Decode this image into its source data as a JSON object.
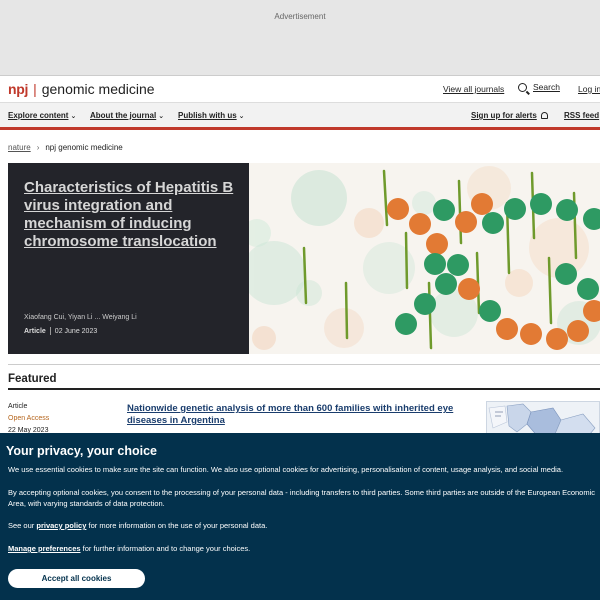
{
  "ad": {
    "label": "Advertisement"
  },
  "header": {
    "brand_prefix": "npj",
    "brand_separator": "|",
    "brand_name": "genomic medicine",
    "view_all_journals": "View all journals",
    "search_label": "Search",
    "login_label": "Log in"
  },
  "nav": {
    "explore_content": "Explore content",
    "about_journal": "About the journal",
    "publish_with_us": "Publish with us",
    "sign_up_alerts": "Sign up for alerts",
    "rss_feed": "RSS feed"
  },
  "breadcrumb": {
    "root": "nature",
    "separator": "›",
    "current": "npj genomic medicine"
  },
  "hero": {
    "title": "Characteristics of Hepatitis B virus integration and mechanism of inducing chromosome translocation",
    "authors": "Xiaofang Cui, Yiyan Li ... Weiyang Li",
    "type": "Article",
    "date": "02 June 2023"
  },
  "featured": {
    "heading": "Featured",
    "article": {
      "type": "Article",
      "access": "Open Access",
      "date": "22 May 2023",
      "title": "Nationwide genetic analysis of more than 600 families with inherited eye diseases in Argentina"
    }
  },
  "cookie_banner": {
    "title": "Your privacy, your choice",
    "p1": "We use essential cookies to make sure the site can function. We also use optional cookies for advertising, personalisation of content, usage analysis, and social media.",
    "p2": "By accepting optional cookies, you consent to the processing of your personal data - including transfers to third parties. Some third parties are outside of the European Economic Area, with varying standards of data protection.",
    "p3_before": "See our",
    "p3_link": "privacy policy",
    "p3_after": "for more information on the use of your personal data.",
    "p4_link": "Manage preferences",
    "p4_after": "for further information and to change your choices.",
    "accept_button": "Accept all cookies"
  },
  "colors": {
    "brand_red": "#c0392b",
    "nav_bg": "#f2f2f2",
    "hero_panel": "#23242a",
    "link_blue": "#1a3d6d",
    "cookie_bg": "#03314c",
    "open_access": "#b5651d"
  }
}
